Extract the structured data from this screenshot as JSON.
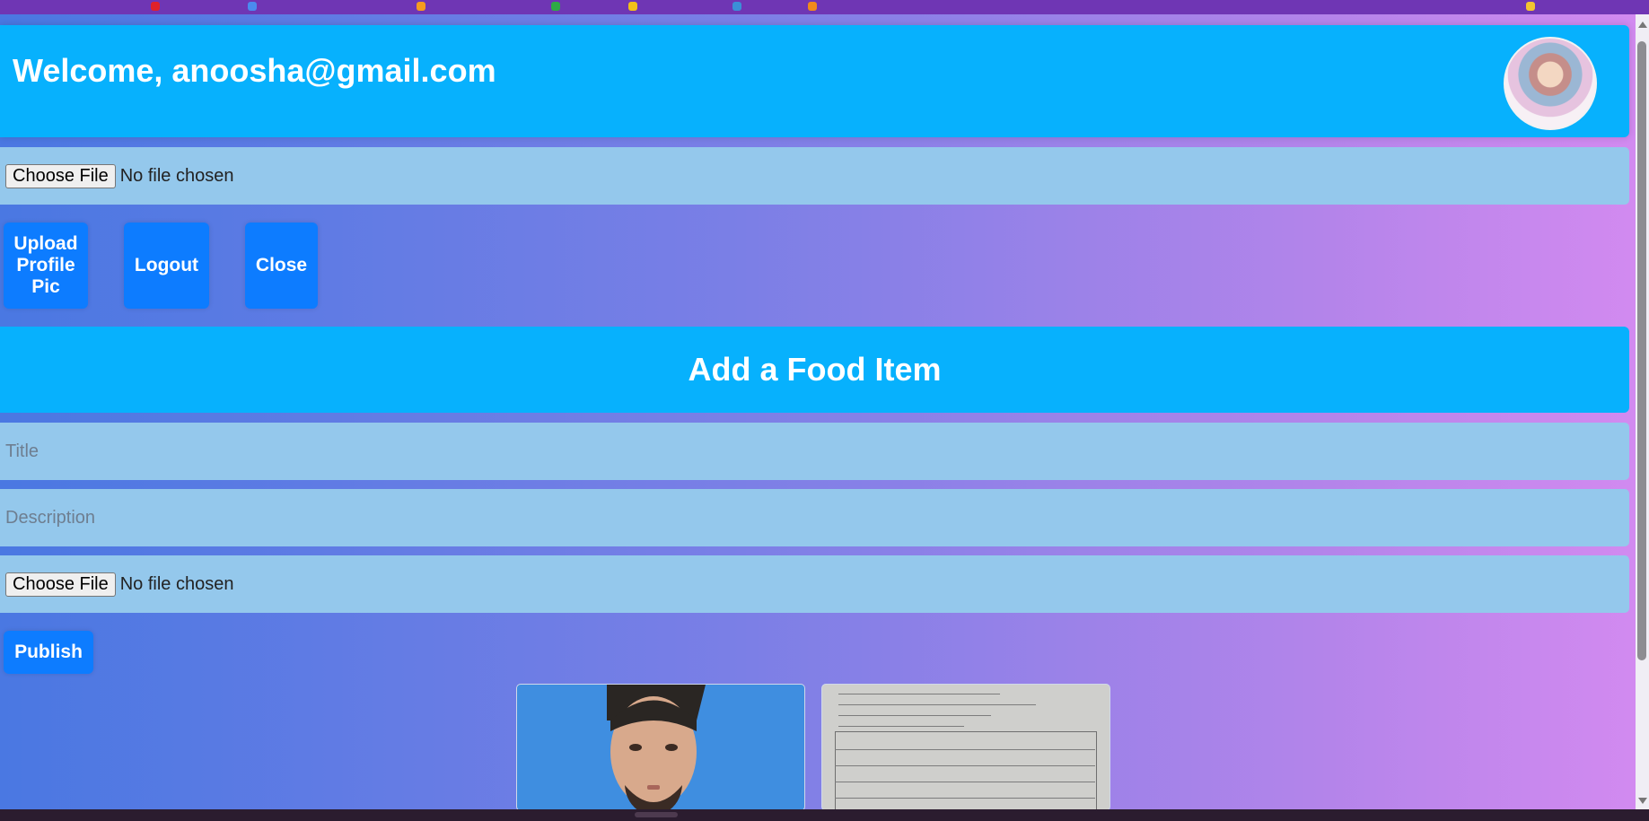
{
  "header": {
    "welcome_text": "Welcome, anoosha@gmail.com",
    "avatar_alt": "profile avatar"
  },
  "profile_upload": {
    "choose_file_label": "Choose File",
    "file_status": "No file chosen"
  },
  "actions": {
    "upload_label": "Upload Profile Pic",
    "logout_label": "Logout",
    "close_label": "Close"
  },
  "food_form": {
    "heading": "Add a Food Item",
    "title_placeholder": "Title",
    "description_placeholder": "Description",
    "choose_file_label": "Choose File",
    "file_status": "No file chosen",
    "publish_label": "Publish"
  },
  "colors": {
    "header_bg": "#07b1fd",
    "button_bg": "#0d7cff",
    "field_bg": "#94c8ec",
    "browser_bar": "#6f36b4"
  }
}
